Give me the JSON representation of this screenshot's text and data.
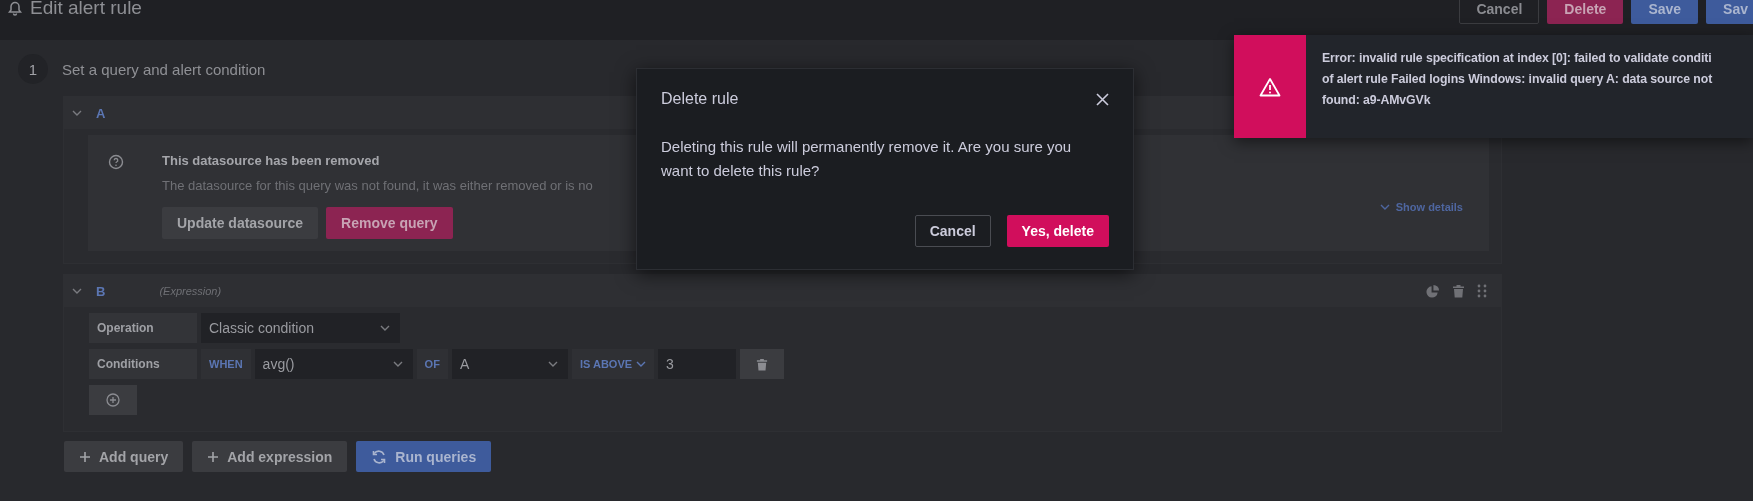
{
  "header": {
    "title": "Edit alert rule",
    "buttons": [
      {
        "label": "Cancel",
        "kind": "secondary"
      },
      {
        "label": "Delete",
        "kind": "destructive"
      },
      {
        "label": "Save",
        "kind": "primary"
      },
      {
        "label": "Sav",
        "kind": "primary"
      }
    ]
  },
  "step": {
    "number": "1",
    "title": "Set a query and alert condition"
  },
  "queries": [
    {
      "ref": "A",
      "kind": "query",
      "alert": {
        "title": "This datasource has been removed",
        "text": "The datasource for this query was not found, it was either removed or is no",
        "buttons": [
          {
            "label": "Update datasource",
            "kind": "secondary"
          },
          {
            "label": "Remove query",
            "kind": "destructive"
          }
        ],
        "details": "Show details"
      }
    },
    {
      "ref": "B",
      "kind": "expression",
      "subtitle": "(Expression)",
      "operation": {
        "label": "Operation",
        "value": "Classic condition"
      },
      "conditions": {
        "label": "Conditions",
        "when": "WHEN",
        "reducer": "avg()",
        "of": "OF",
        "query": "A",
        "evaluator": "IS ABOVE",
        "threshold": "3"
      }
    }
  ],
  "actions": [
    {
      "label": "Add query",
      "kind": "secondary"
    },
    {
      "label": "Add expression",
      "kind": "secondary"
    },
    {
      "label": "Run queries",
      "kind": "primary"
    }
  ],
  "modal": {
    "title": "Delete rule",
    "body": "Deleting this rule will permanently remove it. Are you sure you want to delete this rule?",
    "buttons": [
      {
        "label": "Cancel",
        "kind": "secondary"
      },
      {
        "label": "Yes, delete",
        "kind": "destructive"
      }
    ]
  },
  "toast": {
    "lines": [
      "Error: invalid rule specification at index [0]: failed to validate conditi",
      "of alert rule Failed logins Windows: invalid query A: data source not",
      "found: a9-AMvGVk"
    ]
  }
}
